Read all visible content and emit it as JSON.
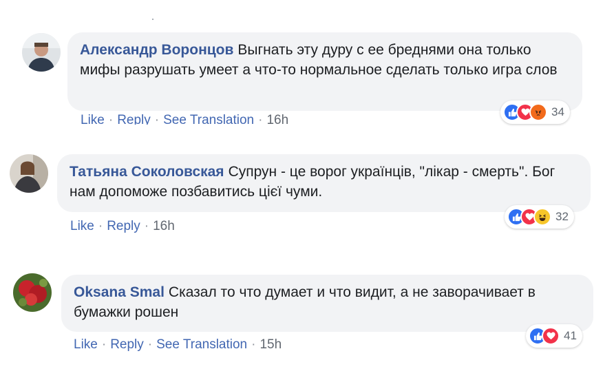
{
  "comments": [
    {
      "author": "Александр Воронцов",
      "text": "Выгнать эту дуру с ее бреднями она только мифы разрушать умеет а что-то нормальное сделать только игра слов",
      "actions": {
        "like": "Like",
        "reply": "Reply",
        "translate": "See Translation",
        "time": "16h",
        "sep": "·"
      },
      "reactions": {
        "icons": [
          "like-icon",
          "love-icon",
          "angry-icon"
        ],
        "count": "34"
      }
    },
    {
      "author": "Татьяна Соколовская",
      "text": "Супрун - це ворог українців, \"лікар - смерть\". Бог нам допоможе позбавитись цієї чуми.",
      "actions": {
        "like": "Like",
        "reply": "Reply",
        "time": "16h",
        "sep": "·"
      },
      "reactions": {
        "icons": [
          "like-icon",
          "love-icon",
          "haha-icon"
        ],
        "count": "32"
      }
    },
    {
      "author": "Oksana Smal",
      "text": "Сказал то что думает и что видит, а не заворачивает в бумажки рошен",
      "actions": {
        "like": "Like",
        "reply": "Reply",
        "translate": "See Translation",
        "time": "15h",
        "sep": "·"
      },
      "reactions": {
        "icons": [
          "like-icon",
          "love-icon"
        ],
        "count": "41"
      }
    }
  ],
  "colors": {
    "author": "#385898",
    "link": "#4267b2",
    "bubble": "#f2f3f5"
  }
}
